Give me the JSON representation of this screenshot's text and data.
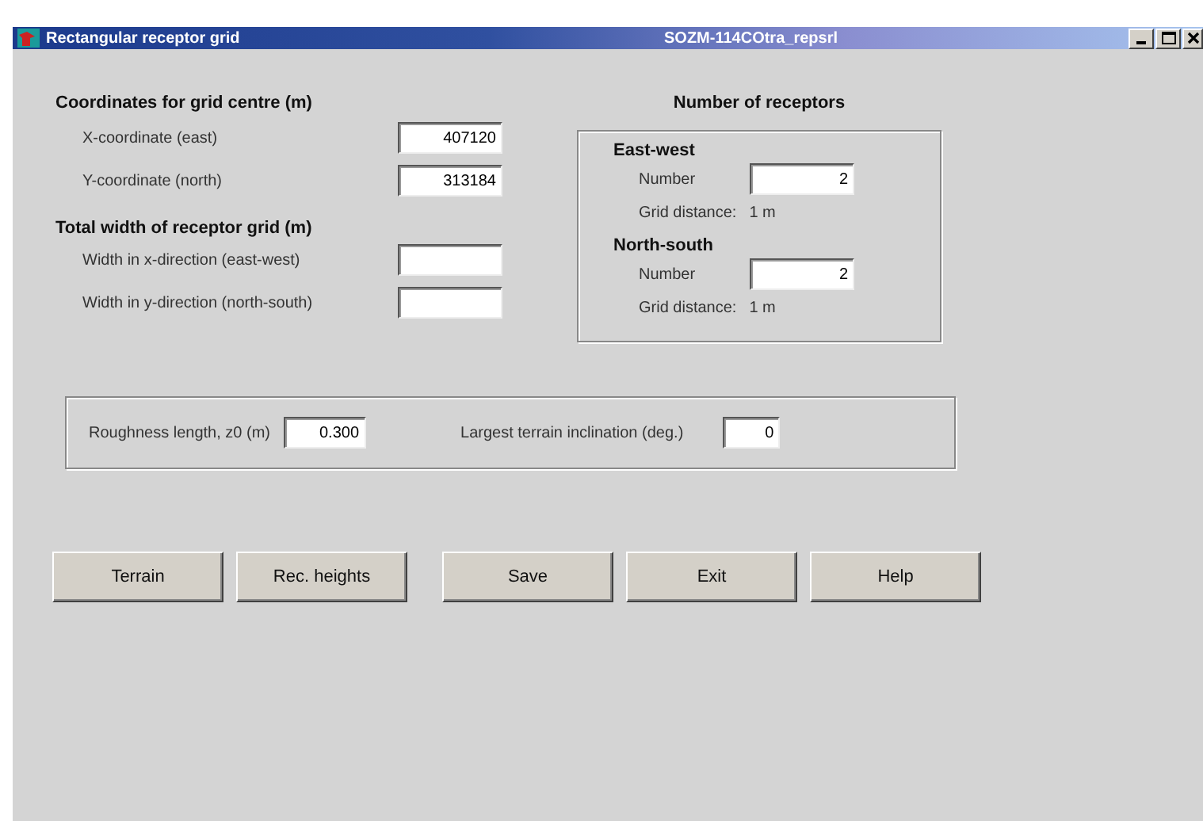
{
  "window": {
    "title": "Rectangular receptor grid",
    "document": "SOZM-114COtra_repsrl"
  },
  "grid_centre": {
    "heading": "Coordinates for grid centre (m)",
    "fields": [
      {
        "label": "X-coordinate (east)",
        "value": "407120"
      },
      {
        "label": "Y-coordinate (north)",
        "value": "313184"
      }
    ]
  },
  "grid_width": {
    "heading": "Total width of receptor grid (m)",
    "fields": [
      {
        "label": "Width in x-direction (east-west)"
      },
      {
        "label": "Width in y-direction (north-south)"
      }
    ]
  },
  "receptors": {
    "heading": "Number of receptors",
    "groups": [
      {
        "heading": "East-west",
        "number_label": "Number",
        "number": "2",
        "distance_label": "Grid distance:",
        "distance": "1 m"
      },
      {
        "heading": "North-south",
        "number_label": "Number",
        "number": "2",
        "distance_label": "Grid distance:",
        "distance": "1 m"
      }
    ]
  },
  "terrain": {
    "fields": [
      {
        "label": "Roughness length, z0 (m)",
        "value": "0.300"
      },
      {
        "label": "Largest terrain inclination (deg.)",
        "value": "0"
      }
    ]
  },
  "buttons": [
    "Terrain",
    "Rec. heights",
    "Save",
    "Exit",
    "Help"
  ]
}
